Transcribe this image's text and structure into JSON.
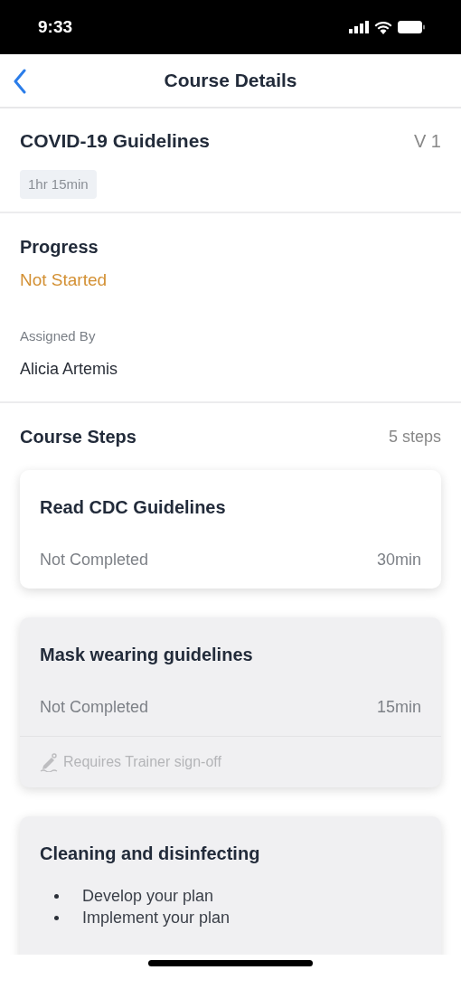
{
  "status_bar": {
    "time": "9:33"
  },
  "nav": {
    "title": "Course Details"
  },
  "course": {
    "title": "COVID-19 Guidelines",
    "version": "V 1",
    "duration": "1hr 15min"
  },
  "progress": {
    "label": "Progress",
    "status": "Not Started"
  },
  "assigned": {
    "label": "Assigned By",
    "name": "Alicia Artemis"
  },
  "steps_header": {
    "title": "Course Steps",
    "count": "5 steps"
  },
  "steps": [
    {
      "title": "Read CDC Guidelines",
      "locked": false,
      "status": "Not Completed",
      "duration": "30min"
    },
    {
      "title": "Mask wearing guidelines",
      "locked": true,
      "status": "Not Completed",
      "duration": "15min",
      "note": "Requires Trainer sign-off"
    },
    {
      "title": "Cleaning and disinfecting",
      "locked": true,
      "bullets": [
        "Develop your plan",
        "Implement your plan"
      ]
    }
  ]
}
